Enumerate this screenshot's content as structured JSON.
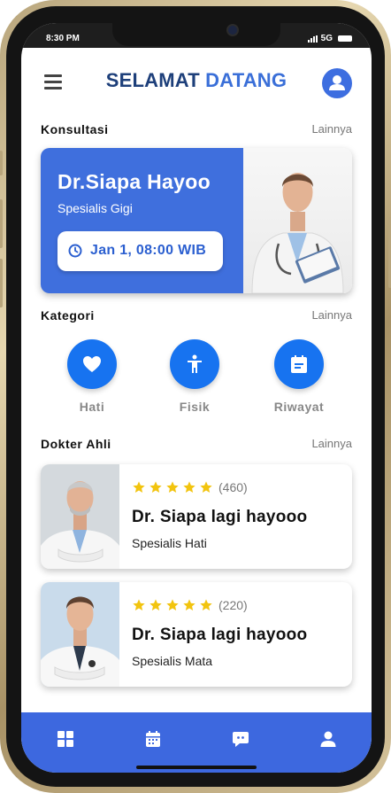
{
  "status_bar": {
    "time": "8:30 PM",
    "network": "5G"
  },
  "header": {
    "title_part1": "SELAMAT",
    "title_part2": "DATANG"
  },
  "consultation": {
    "heading": "Konsultasi",
    "more_label": "Lainnya",
    "doctor_name": "Dr.Siapa Hayoo",
    "specialty": "Spesialis Gigi",
    "appointment": "Jan 1, 08:00 WIB"
  },
  "categories": {
    "heading": "Kategori",
    "more_label": "Lainnya",
    "items": [
      {
        "label": "Hati",
        "icon": "heart-icon"
      },
      {
        "label": "Fisik",
        "icon": "body-icon"
      },
      {
        "label": "Riwayat",
        "icon": "calendar-icon"
      }
    ]
  },
  "experts": {
    "heading": "Dokter Ahli",
    "more_label": "Lainnya",
    "doctors": [
      {
        "rating_count": "(460)",
        "stars": 5,
        "name": "Dr. Siapa lagi hayooo",
        "specialty": "Spesialis Hati"
      },
      {
        "rating_count": "(220)",
        "stars": 5,
        "name": "Dr. Siapa lagi hayooo",
        "specialty": "Spesialis Mata"
      }
    ]
  },
  "bottom_nav": {
    "items": [
      "grid-icon",
      "calendar-icon",
      "chat-icon",
      "user-icon"
    ]
  },
  "colors": {
    "primary": "#3f6fdd",
    "accent": "#1773f0",
    "star": "#f2c40f",
    "title_dark": "#1d3f7a"
  }
}
